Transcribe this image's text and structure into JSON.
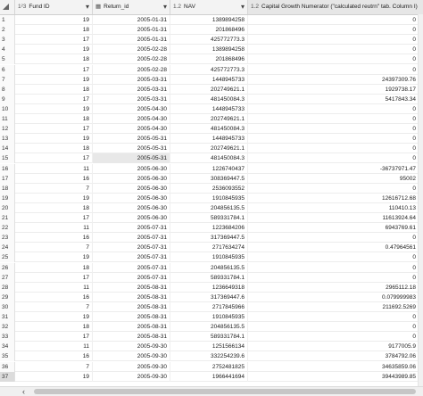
{
  "columns": [
    {
      "type_icon": "1²3",
      "label": "Fund ID"
    },
    {
      "type_icon": "▦",
      "label": "Return_id"
    },
    {
      "type_icon": "1.2",
      "label": "NAV"
    },
    {
      "type_icon": "1.2",
      "label": "Capital Growth Numerator (\"calculated reutrn\" tab. Column I)"
    }
  ],
  "rows": [
    {
      "n": "1",
      "fund": "19",
      "date": "2005-01-31",
      "nav": "1389894258",
      "cg": "0"
    },
    {
      "n": "2",
      "fund": "18",
      "date": "2005-01-31",
      "nav": "201868496",
      "cg": "0"
    },
    {
      "n": "3",
      "fund": "17",
      "date": "2005-01-31",
      "nav": "425772773.3",
      "cg": "0"
    },
    {
      "n": "4",
      "fund": "19",
      "date": "2005-02-28",
      "nav": "1389894258",
      "cg": "0"
    },
    {
      "n": "5",
      "fund": "18",
      "date": "2005-02-28",
      "nav": "201868496",
      "cg": "0"
    },
    {
      "n": "6",
      "fund": "17",
      "date": "2005-02-28",
      "nav": "425772773.3",
      "cg": "0"
    },
    {
      "n": "7",
      "fund": "19",
      "date": "2005-03-31",
      "nav": "1448945733",
      "cg": "24397309.76"
    },
    {
      "n": "8",
      "fund": "18",
      "date": "2005-03-31",
      "nav": "202749621.1",
      "cg": "1929738.17"
    },
    {
      "n": "9",
      "fund": "17",
      "date": "2005-03-31",
      "nav": "481450084.3",
      "cg": "5417843.34"
    },
    {
      "n": "10",
      "fund": "19",
      "date": "2005-04-30",
      "nav": "1448945733",
      "cg": "0"
    },
    {
      "n": "11",
      "fund": "18",
      "date": "2005-04-30",
      "nav": "202749621.1",
      "cg": "0"
    },
    {
      "n": "12",
      "fund": "17",
      "date": "2005-04-30",
      "nav": "481450084.3",
      "cg": "0"
    },
    {
      "n": "13",
      "fund": "19",
      "date": "2005-05-31",
      "nav": "1448945733",
      "cg": "0"
    },
    {
      "n": "14",
      "fund": "18",
      "date": "2005-05-31",
      "nav": "202749621.1",
      "cg": "0"
    },
    {
      "n": "15",
      "fund": "17",
      "date": "2005-05-31",
      "nav": "481450084.3",
      "cg": "0"
    },
    {
      "n": "16",
      "fund": "11",
      "date": "2005-06-30",
      "nav": "1226740437",
      "cg": "-36737971.47"
    },
    {
      "n": "17",
      "fund": "16",
      "date": "2005-06-30",
      "nav": "308369447.5",
      "cg": "95002"
    },
    {
      "n": "18",
      "fund": "7",
      "date": "2005-06-30",
      "nav": "2536093552",
      "cg": "0"
    },
    {
      "n": "19",
      "fund": "19",
      "date": "2005-06-30",
      "nav": "1910845935",
      "cg": "12616712.68"
    },
    {
      "n": "20",
      "fund": "18",
      "date": "2005-06-30",
      "nav": "204856135.5",
      "cg": "110410.13"
    },
    {
      "n": "21",
      "fund": "17",
      "date": "2005-06-30",
      "nav": "589331784.1",
      "cg": "11613924.64"
    },
    {
      "n": "22",
      "fund": "11",
      "date": "2005-07-31",
      "nav": "1223684206",
      "cg": "6943769.61"
    },
    {
      "n": "23",
      "fund": "16",
      "date": "2005-07-31",
      "nav": "317369447.5",
      "cg": "0"
    },
    {
      "n": "24",
      "fund": "7",
      "date": "2005-07-31",
      "nav": "2717634274",
      "cg": "0.47964561"
    },
    {
      "n": "25",
      "fund": "19",
      "date": "2005-07-31",
      "nav": "1910845935",
      "cg": "0"
    },
    {
      "n": "26",
      "fund": "18",
      "date": "2005-07-31",
      "nav": "204856135.5",
      "cg": "0"
    },
    {
      "n": "27",
      "fund": "17",
      "date": "2005-07-31",
      "nav": "589331784.1",
      "cg": "0"
    },
    {
      "n": "28",
      "fund": "11",
      "date": "2005-08-31",
      "nav": "1236649318",
      "cg": "2965112.18"
    },
    {
      "n": "29",
      "fund": "16",
      "date": "2005-08-31",
      "nav": "317369447.6",
      "cg": "0.079999983"
    },
    {
      "n": "30",
      "fund": "7",
      "date": "2005-08-31",
      "nav": "2717845966",
      "cg": "211692.5269"
    },
    {
      "n": "31",
      "fund": "19",
      "date": "2005-08-31",
      "nav": "1910845935",
      "cg": "0"
    },
    {
      "n": "32",
      "fund": "18",
      "date": "2005-08-31",
      "nav": "204856135.5",
      "cg": "0"
    },
    {
      "n": "33",
      "fund": "17",
      "date": "2005-08-31",
      "nav": "589331784.1",
      "cg": "0"
    },
    {
      "n": "34",
      "fund": "11",
      "date": "2005-09-30",
      "nav": "1251566134",
      "cg": "9177005.9"
    },
    {
      "n": "35",
      "fund": "16",
      "date": "2005-09-30",
      "nav": "332254239.6",
      "cg": "3784792.06"
    },
    {
      "n": "36",
      "fund": "7",
      "date": "2005-09-30",
      "nav": "2752481825",
      "cg": "34635859.06"
    },
    {
      "n": "37",
      "fund": "19",
      "date": "2005-09-30",
      "nav": "1966441694",
      "cg": "39443989.85"
    }
  ]
}
